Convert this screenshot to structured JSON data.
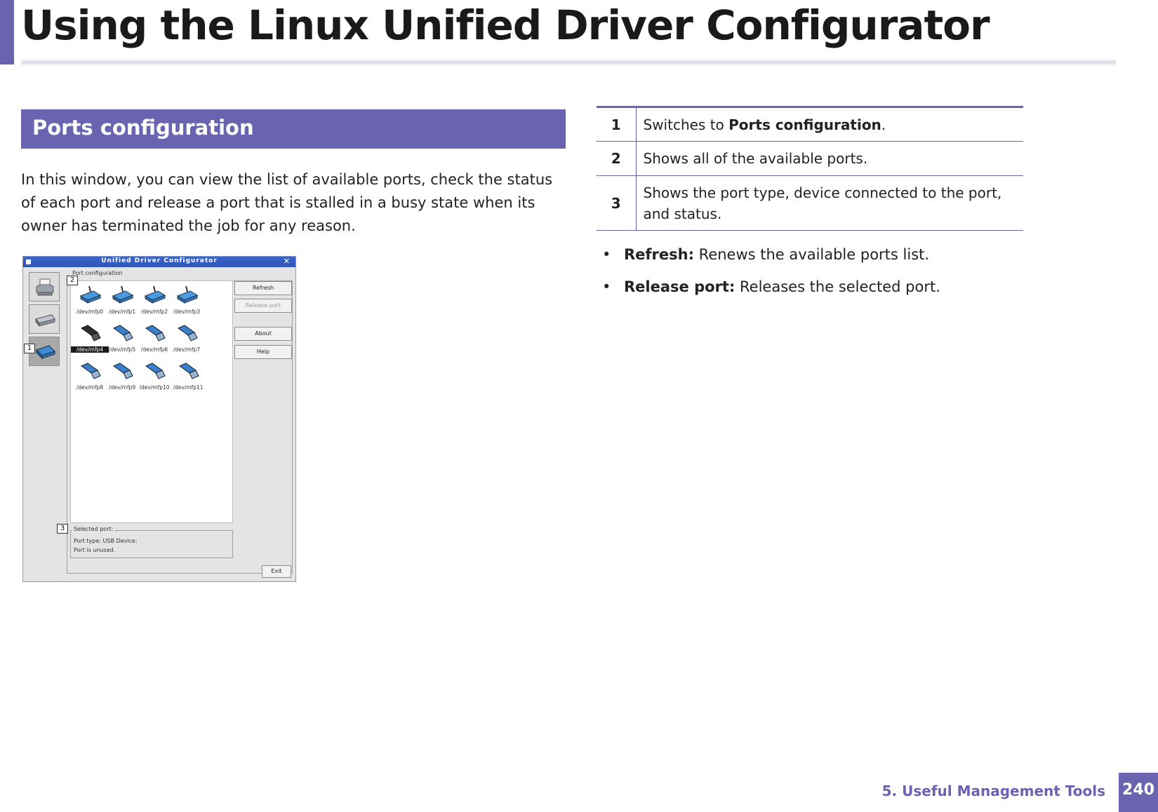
{
  "header": {
    "title": "Using the Linux Unified Driver Configurator"
  },
  "section": {
    "title": "Ports configuration",
    "intro": "In this window, you can view the list of available ports, check the status of each port and release a port that is stalled in a busy state when its owner has terminated the job for any reason."
  },
  "screenshot": {
    "window_title": "Unified Driver Configurator",
    "close_glyph": "✕",
    "group_label": "Port configuration",
    "ports": [
      {
        "label": "/dev/mfp0",
        "type": "parallel"
      },
      {
        "label": "/dev/mfp1",
        "type": "parallel"
      },
      {
        "label": "/dev/mfp2",
        "type": "parallel"
      },
      {
        "label": "/dev/mfp3",
        "type": "parallel"
      },
      {
        "label": "/dev/mfp4",
        "type": "usb",
        "selected": true
      },
      {
        "label": "/dev/mfp5",
        "type": "usb"
      },
      {
        "label": "/dev/mfp6",
        "type": "usb"
      },
      {
        "label": "/dev/mfp7",
        "type": "usb"
      },
      {
        "label": "/dev/mfp8",
        "type": "usb"
      },
      {
        "label": "/dev/mfp9",
        "type": "usb"
      },
      {
        "label": "/dev/mfp10",
        "type": "usb"
      },
      {
        "label": "/dev/mfp11",
        "type": "usb"
      }
    ],
    "buttons": {
      "refresh": "Refresh",
      "release_port": "Release port",
      "about": "About",
      "help": "Help",
      "exit": "Exit"
    },
    "selected_port": {
      "label": "Selected port:",
      "line1": "Port type: USB    Device:",
      "line2": "Port is unused."
    },
    "callouts": {
      "c1": "1",
      "c2": "2",
      "c3": "3"
    },
    "sidebar_icons": [
      "printer-icon",
      "scanner-icon",
      "port-icon"
    ]
  },
  "table": {
    "rows": [
      {
        "num": "1",
        "text_before": "Switches to ",
        "bold": "Ports configuration",
        "text_after": "."
      },
      {
        "num": "2",
        "text_before": "Shows all of the available ports.",
        "bold": "",
        "text_after": ""
      },
      {
        "num": "3",
        "text_before": "Shows the port type, device connected to the port, and status.",
        "bold": "",
        "text_after": ""
      }
    ]
  },
  "bullets": [
    {
      "term": "Refresh:",
      "text": " Renews the available ports list."
    },
    {
      "term": "Release port:",
      "text": " Releases the selected port."
    }
  ],
  "footer": {
    "chapter": "5.  Useful Management Tools",
    "page": "240"
  },
  "colors": {
    "accent": "#6a64b0",
    "titlebar": "#3b63c9"
  }
}
